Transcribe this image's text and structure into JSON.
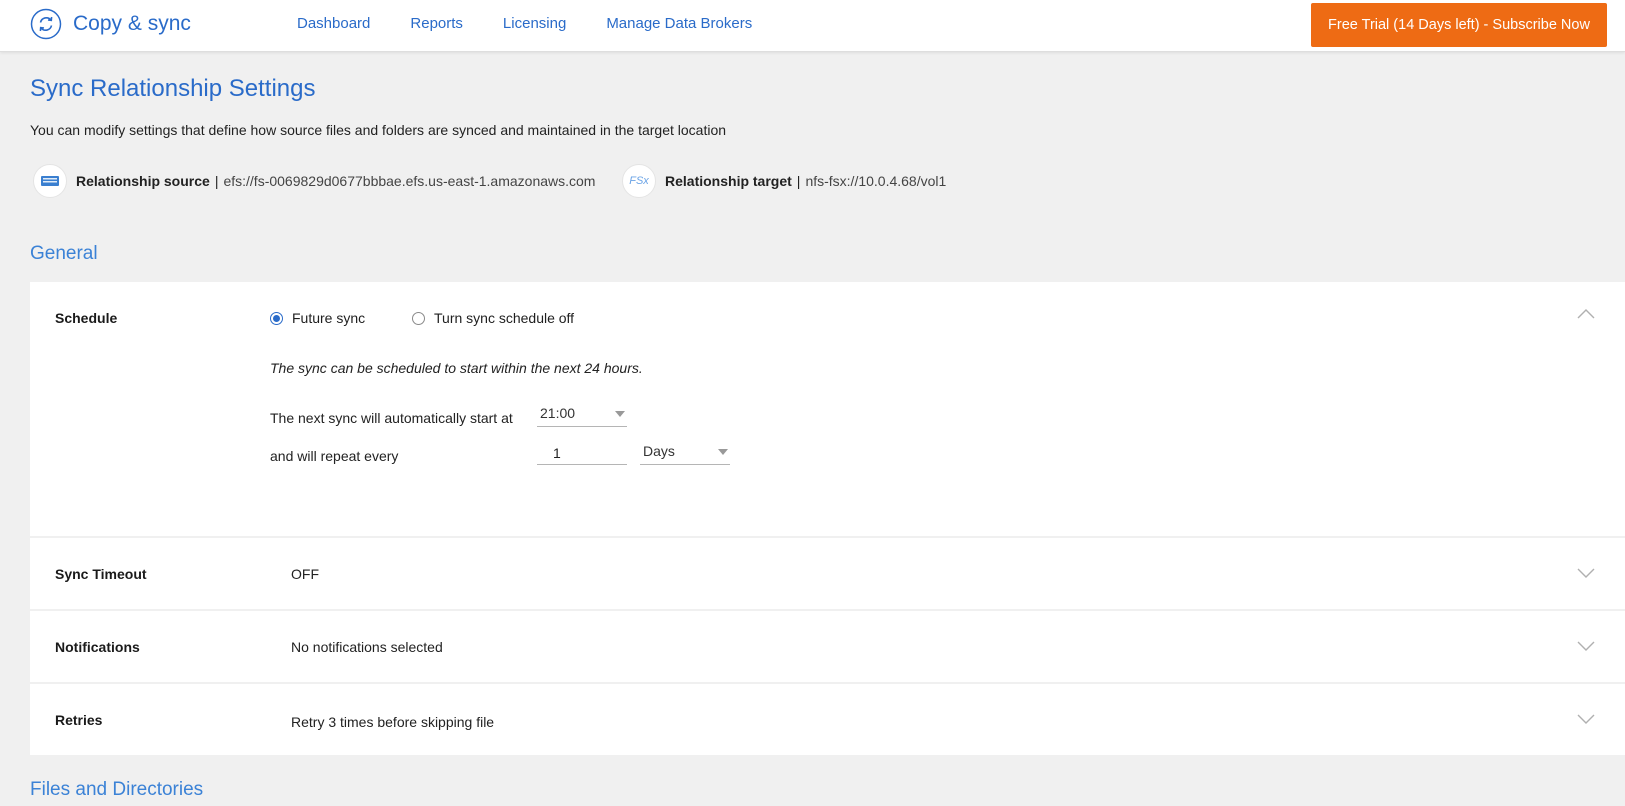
{
  "app": {
    "name": "Copy & sync"
  },
  "nav": [
    "Dashboard",
    "Reports",
    "Licensing",
    "Manage Data Brokers"
  ],
  "cta_label": "Free Trial (14 Days left) - Subscribe Now",
  "page": {
    "title": "Sync Relationship Settings",
    "subtitle": "You can modify settings that define how source files and folders are synced and maintained in the target location"
  },
  "relationship": {
    "source_label": "Relationship source",
    "source_value": "efs://fs-0069829d0677bbbae.efs.us-east-1.amazonaws.com",
    "target_label": "Relationship target",
    "target_value": "nfs-fsx://10.0.4.68/vol1",
    "target_icon_text": "FSx"
  },
  "sections": {
    "general": "General",
    "files": "Files and Directories"
  },
  "schedule": {
    "label": "Schedule",
    "option_future": "Future sync",
    "option_off": "Turn sync schedule off",
    "selected": "Future sync",
    "note": "The sync can be scheduled to start within the next 24 hours.",
    "start_label": "The next sync will automatically start at",
    "start_time": "21:00",
    "repeat_label": "and will repeat every",
    "repeat_value": "1",
    "repeat_unit": "Days"
  },
  "rows": [
    {
      "label": "Sync Timeout",
      "value": "OFF"
    },
    {
      "label": "Notifications",
      "value": "No notifications selected"
    },
    {
      "label": "Retries",
      "value": "Retry 3 times before skipping file"
    }
  ],
  "colors": {
    "brand": "#2a6bc9",
    "cta": "#ee6b14",
    "background": "#f0f0f0"
  },
  "icons": {
    "brand": "sync-circle-icon",
    "source": "efs-storage-icon",
    "target": "fsx-icon",
    "collapse": "chevron-up-icon",
    "expand": "chevron-down-icon"
  }
}
